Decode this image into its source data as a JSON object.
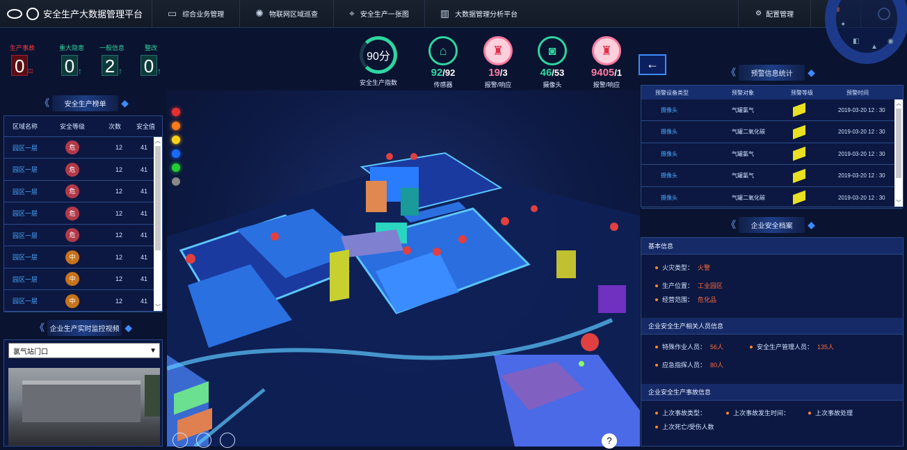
{
  "header": {
    "app_title": "安全生产大数据管理平台"
  },
  "nav": [
    {
      "label": "综合业务管理",
      "icon": "monitor-icon"
    },
    {
      "label": "物联网区域巡查",
      "icon": "sparkle-icon"
    },
    {
      "label": "安全生产一张图",
      "icon": "map-pin-icon"
    },
    {
      "label": "大数据管理分析平台",
      "icon": "bar-chart-icon"
    }
  ],
  "topright": {
    "config_label": "配置管理",
    "task_badge": "8"
  },
  "counters": [
    {
      "label": "生产事故",
      "value": "0",
      "color": "#ff3b3b"
    },
    {
      "label": "重大隐患",
      "value": "0",
      "color": "#2ed6a0"
    },
    {
      "label": "一般信息",
      "value": "2",
      "color": "#2ed6a0"
    },
    {
      "label": "整改",
      "value": "0",
      "color": "#2ed6a0"
    }
  ],
  "stats": [
    {
      "value": "90分",
      "caption": "安全生产指数",
      "color": "#2ed6a0"
    },
    {
      "a": "92",
      "b": "/92",
      "caption": "传感器",
      "color": "#2ed6a0"
    },
    {
      "a": "19",
      "b": "/3",
      "caption": "报警/响应",
      "color": "#ff7aa0"
    },
    {
      "a": "46",
      "b": "/53",
      "caption": "摄像头",
      "color": "#2ed6a0"
    },
    {
      "a": "9405",
      "b": "/1",
      "caption": "报警/响应",
      "color": "#ff7aa0"
    }
  ],
  "ranking": {
    "title": "安全生产榜单",
    "headers": [
      "区域名称",
      "安全等级",
      "次数",
      "安全值"
    ],
    "rows": [
      {
        "name": "园区一层",
        "level": "危",
        "count": "12",
        "value": "41"
      },
      {
        "name": "园区一层",
        "level": "危",
        "count": "12",
        "value": "41"
      },
      {
        "name": "园区一层",
        "level": "危",
        "count": "12",
        "value": "41"
      },
      {
        "name": "园区一层",
        "level": "危",
        "count": "12",
        "value": "41"
      },
      {
        "name": "园区一层",
        "level": "危",
        "count": "12",
        "value": "41"
      },
      {
        "name": "园区一层",
        "level": "中",
        "count": "12",
        "value": "41"
      },
      {
        "name": "园区一层",
        "level": "中",
        "count": "12",
        "value": "41"
      },
      {
        "name": "园区一层",
        "level": "中",
        "count": "12",
        "value": "41"
      }
    ]
  },
  "monitor": {
    "title": "企业生产实时监控视频",
    "selected": "氯气站门口"
  },
  "warning": {
    "title": "预警信息统计",
    "headers": [
      "预警设备类型",
      "预警对象",
      "预警等级",
      "预警时间"
    ],
    "rows": [
      {
        "type": "摄像头",
        "obj": "气罐氯气",
        "time": "2019-03-20  12 : 30"
      },
      {
        "type": "摄像头",
        "obj": "气罐二氧化碳",
        "time": "2019-03-20  12 : 30"
      },
      {
        "type": "摄像头",
        "obj": "气罐氯气",
        "time": "2019-03-20  12 : 30"
      },
      {
        "type": "摄像头",
        "obj": "气罐氯气",
        "time": "2019-03-20  12 : 30"
      },
      {
        "type": "摄像头",
        "obj": "气罐二氧化碳",
        "time": "2019-03-20  12 : 30"
      }
    ]
  },
  "archive": {
    "title": "企业安全档案",
    "basic_h": "基本信息",
    "fire_label": "火灾类型：",
    "fire_value": "火警",
    "loc_label": "生产位置：",
    "loc_value": "工业园区",
    "scope_label": "经营范围：",
    "scope_value": "危化品",
    "staff_h": "企业安全生产相关人员信息",
    "special_label": "特殊作业人员：",
    "special_value": "56人",
    "mgr_label": "安全生产管理人员：",
    "mgr_value": "135人",
    "cmd_label": "应急指挥人员：",
    "cmd_value": "80人",
    "acc_h": "企业安全生产事故信息",
    "acc_type": "上次事故类型：",
    "acc_time": "上次事故发生时间：",
    "acc_handle": "上次事故处理",
    "acc_dead": "上次死亡/受伤人数"
  },
  "legend_lights": [
    "#e53030",
    "#ff7a1a",
    "#ffd21a",
    "#1a6bff",
    "#22cc33",
    "#888888"
  ]
}
